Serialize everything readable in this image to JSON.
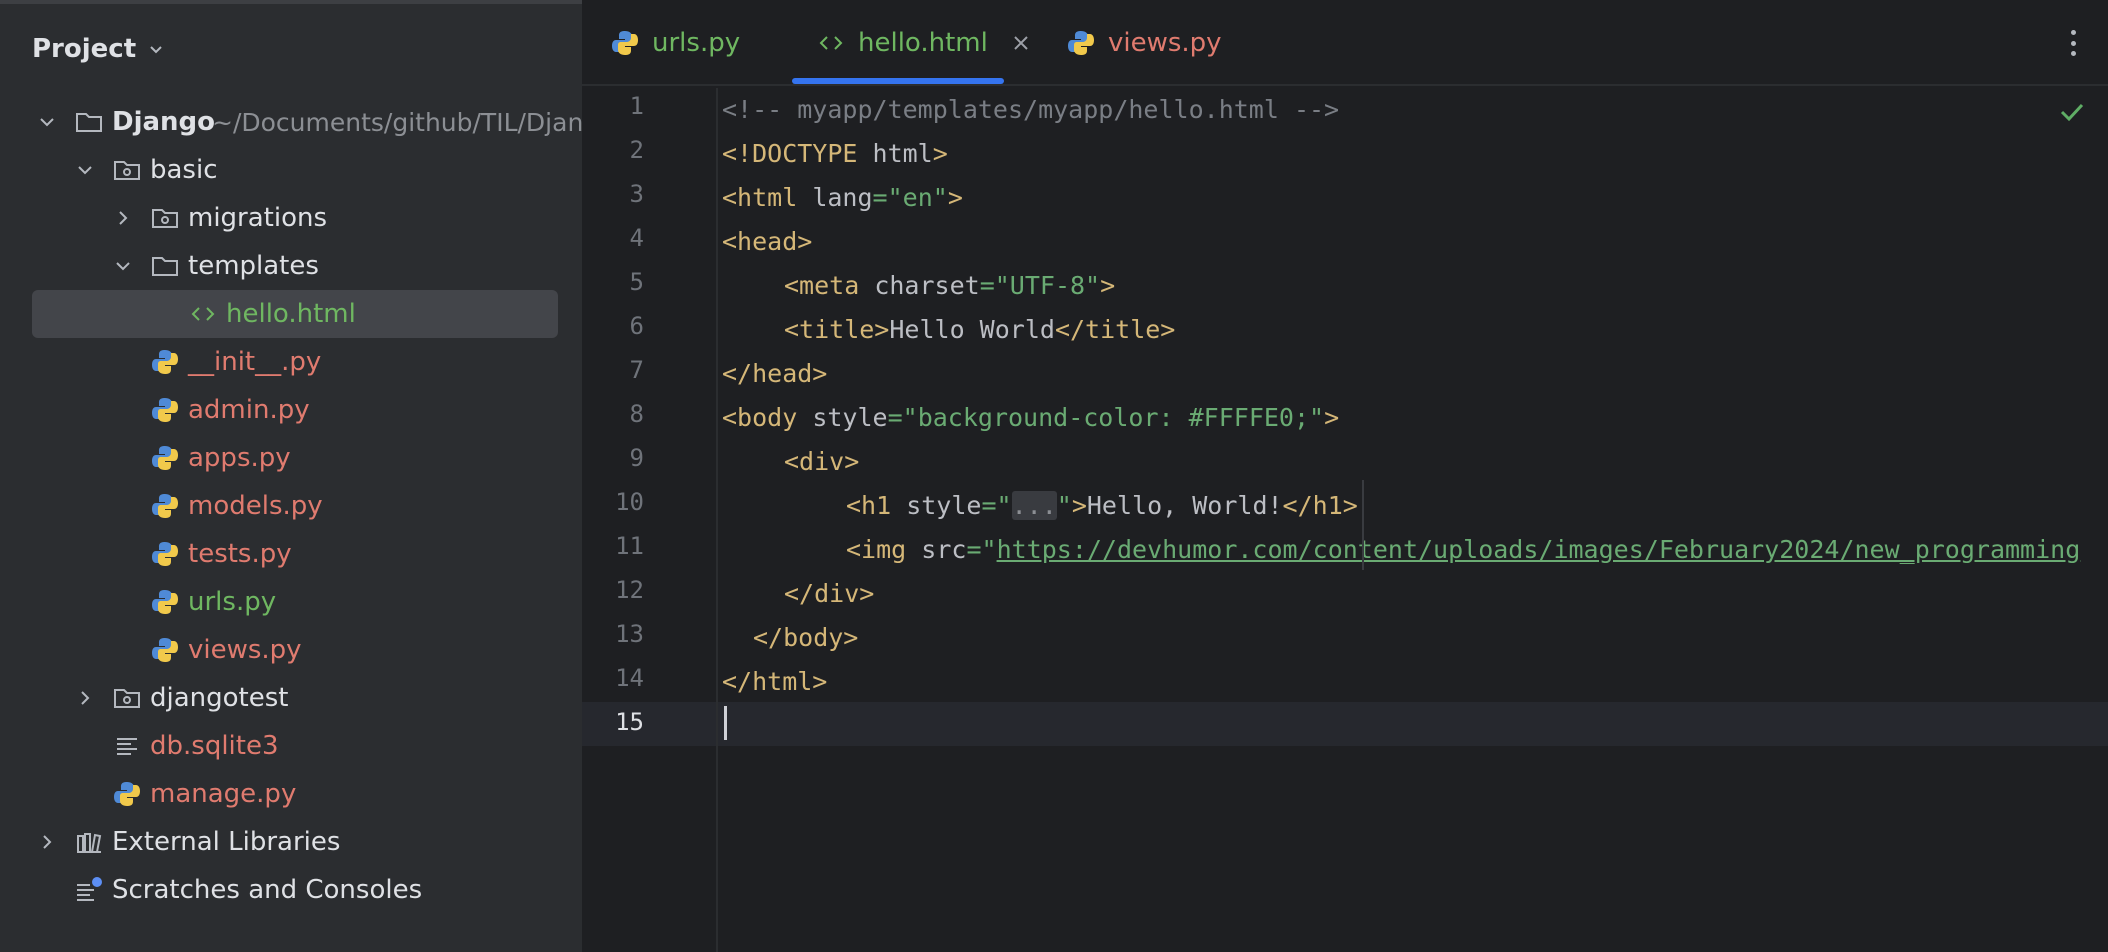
{
  "sidebar": {
    "title": "Project",
    "tree": [
      {
        "label": "Django",
        "path": "~/Documents/github/TIL/Djang"
      },
      {
        "label": "basic"
      },
      {
        "label": "migrations"
      },
      {
        "label": "templates"
      },
      {
        "label": "hello.html"
      },
      {
        "label": "__init__.py"
      },
      {
        "label": "admin.py"
      },
      {
        "label": "apps.py"
      },
      {
        "label": "models.py"
      },
      {
        "label": "tests.py"
      },
      {
        "label": "urls.py"
      },
      {
        "label": "views.py"
      },
      {
        "label": "djangotest"
      },
      {
        "label": "db.sqlite3"
      },
      {
        "label": "manage.py"
      },
      {
        "label": "External Libraries"
      },
      {
        "label": "Scratches and Consoles"
      }
    ]
  },
  "tabs": [
    {
      "label": "urls.py"
    },
    {
      "label": "hello.html",
      "active": true
    },
    {
      "label": "views.py"
    }
  ],
  "editor": {
    "line_numbers": [
      "1",
      "2",
      "3",
      "4",
      "5",
      "6",
      "7",
      "8",
      "9",
      "10",
      "11",
      "12",
      "13",
      "14",
      "15"
    ],
    "current_line": "15",
    "code": {
      "l1": "<!-- myapp/templates/myapp/hello.html -->",
      "l2_open": "<!DOCTYPE",
      "l2_rest": " html",
      "l2_close": ">",
      "l3_tag": "<html",
      "l3_attr": " lang",
      "l3_eq": "=",
      "l3_val": "\"en\"",
      "l3_close": ">",
      "l4": "<head>",
      "l5_tag": "<meta",
      "l5_attr": " charset",
      "l5_eq": "=",
      "l5_val": "\"UTF-8\"",
      "l5_close": ">",
      "l6_open": "<title>",
      "l6_text": "Hello World",
      "l6_close": "</title>",
      "l7": "</head>",
      "l8_tag": "<body",
      "l8_attr": " style",
      "l8_eq": "=",
      "l8_val": "\"background-color: #FFFFE0;\"",
      "l8_close": ">",
      "l9": "<div>",
      "l10_tag": "<h1",
      "l10_attr": " style",
      "l10_eq": "=",
      "l10_q1": "\"",
      "l10_fold": "...",
      "l10_q2": "\"",
      "l10_gt": ">",
      "l10_text": "Hello, World!",
      "l10_close": "</h1>",
      "l11_tag": "<img",
      "l11_attr": " src",
      "l11_eq": "=",
      "l11_q": "\"",
      "l11_url": "https://devhumor.com/content/uploads/images/February2024/new_programming",
      "l12": "</div>",
      "l13": "</body>",
      "l14": "</html>"
    }
  },
  "colors": {
    "accent": "#3574f0",
    "modified_file": "#e07b6f",
    "added_file": "#6fb761",
    "tag": "#d5b778",
    "string": "#6aab73"
  }
}
